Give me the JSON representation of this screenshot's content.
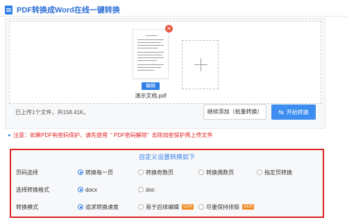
{
  "header": {
    "title": "PDF转换成Word在线一键转换"
  },
  "file": {
    "name": "演示文档.pdf",
    "edit_label": "编辑"
  },
  "upload": {
    "info": "已上传1个文件，共158.41K。",
    "continue_label": "继续添加（批量转换）",
    "start_label": "开始转换"
  },
  "notice": {
    "prefix": "注意：如果PDF有密码保护，请先使用",
    "link": "“ PDF密码解除”",
    "suffix": "去除加密保护再上传文件"
  },
  "settings": {
    "title": "自定义设置转换如下",
    "page_select": {
      "label": "页码选择",
      "options": [
        "转换每一页",
        "转换奇数页",
        "转换偶数页",
        "指定页转换"
      ],
      "selected": 0
    },
    "format": {
      "label": "选择转换格式",
      "options": [
        "docx",
        "doc"
      ],
      "selected": 0
    },
    "mode": {
      "label": "转换模式",
      "options": [
        "追求转换速度",
        "易于后续编辑",
        "尽量保持排版"
      ],
      "ocr_badge": "OCR",
      "selected": 0
    }
  },
  "colors": {
    "accent": "#2f7fe6",
    "alert": "#e02020",
    "ocr": "#f08a24"
  }
}
